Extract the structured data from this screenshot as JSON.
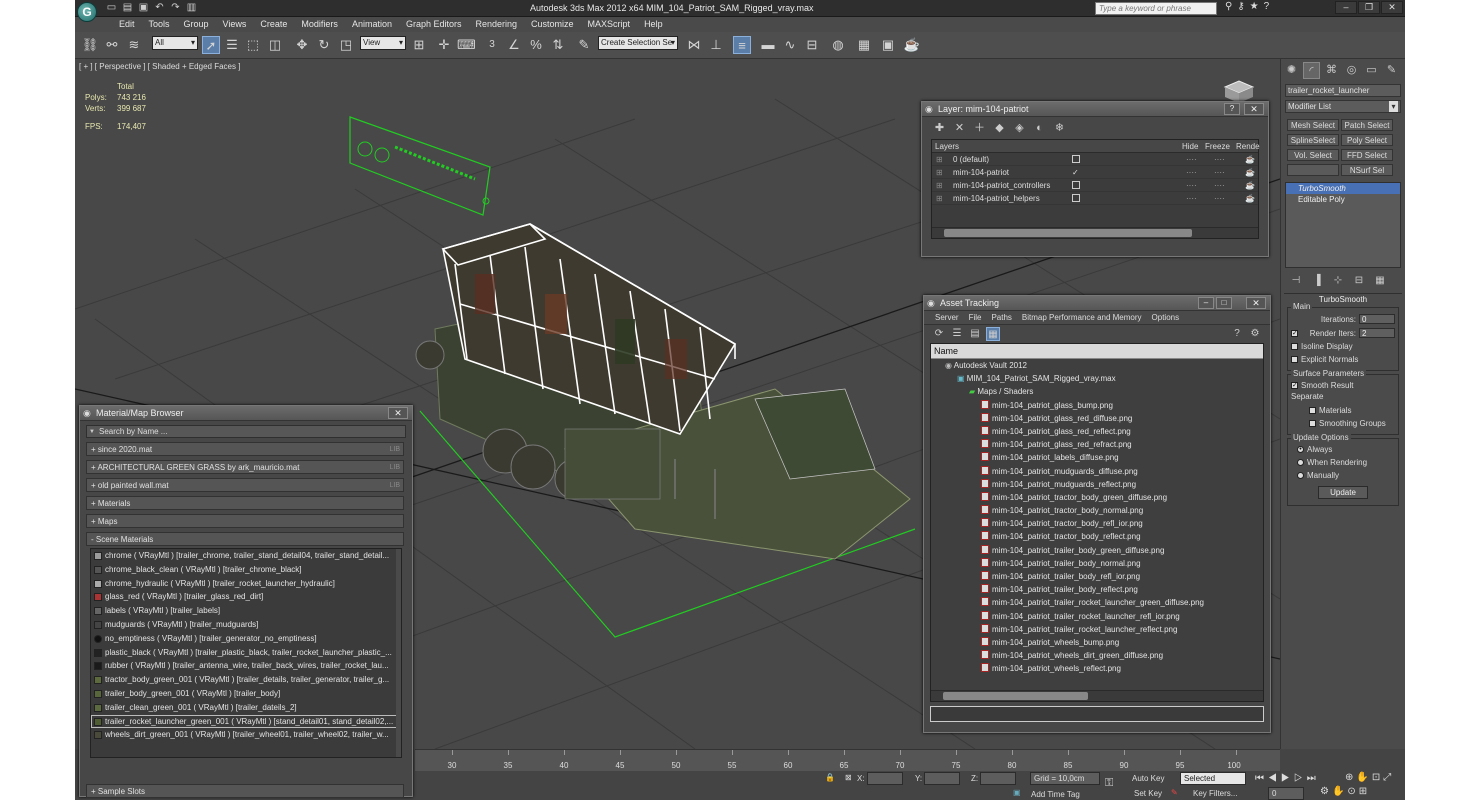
{
  "app": {
    "title": "Autodesk 3ds Max  2012 x64      MIM_104_Patriot_SAM_Rigged_vray.max",
    "logo": "G",
    "search_placeholder": "Type a keyword or phrase"
  },
  "menubar": [
    "Edit",
    "Tools",
    "Group",
    "Views",
    "Create",
    "Modifiers",
    "Animation",
    "Graph Editors",
    "Rendering",
    "Customize",
    "MAXScript",
    "Help"
  ],
  "toolbar": {
    "selection_filter": "All",
    "ref_coord": "View",
    "named_selection": "Create Selection Se",
    "snap_label": "3"
  },
  "viewport": {
    "label": "[ + ] [ Perspective ] [ Shaded + Edged Faces ]",
    "stats_header": "Total",
    "polys_label": "Polys:",
    "polys_value": "743 216",
    "verts_label": "Verts:",
    "verts_value": "399 687",
    "fps_label": "FPS:",
    "fps_value": "174,407"
  },
  "command_panel": {
    "object_name": "trailer_rocket_launcher",
    "modifier_list": "Modifier List",
    "buttons": [
      "Mesh Select",
      "Patch Select",
      "SplineSelect",
      "Poly Select",
      "Vol. Select",
      "FFD Select",
      "",
      "NSurf Sel"
    ],
    "stack": [
      "TurboSmooth",
      "Editable Poly"
    ],
    "turbosmooth": {
      "title": "TurboSmooth",
      "main_label": "Main",
      "iterations_label": "Iterations:",
      "iterations_value": "0",
      "render_iters_label": "Render Iters:",
      "render_iters_value": "2",
      "isoline": "Isoline Display",
      "explicit": "Explicit Normals",
      "surface_label": "Surface Parameters",
      "smooth_result": "Smooth Result",
      "separate": "Separate",
      "materials": "Materials",
      "smoothing_groups": "Smoothing Groups",
      "update_label": "Update Options",
      "always": "Always",
      "when_rendering": "When Rendering",
      "manually": "Manually",
      "update_button": "Update"
    }
  },
  "layers_panel": {
    "title": "Layer: mim-104-patriot",
    "col_layers": "Layers",
    "col_hide": "Hide",
    "col_freeze": "Freeze",
    "col_render": "Rende",
    "rows": [
      {
        "name": "0 (default)",
        "hide": false
      },
      {
        "name": "mim-104-patriot",
        "hide": true
      },
      {
        "name": "mim-104-patriot_controllers",
        "hide": false
      },
      {
        "name": "mim-104-patriot_helpers",
        "hide": false
      }
    ]
  },
  "asset_tracking": {
    "title": "Asset Tracking",
    "menu": [
      "Server",
      "File",
      "Paths",
      "Bitmap Performance and Memory",
      "Options"
    ],
    "col_name": "Name",
    "vault": "Autodesk Vault 2012",
    "file": "MIM_104_Patriot_SAM_Rigged_vray.max",
    "maps_folder": "Maps / Shaders",
    "maps": [
      "mim-104_patriot_glass_bump.png",
      "mim-104_patriot_glass_red_diffuse.png",
      "mim-104_patriot_glass_red_reflect.png",
      "mim-104_patriot_glass_red_refract.png",
      "mim-104_patriot_labels_diffuse.png",
      "mim-104_patriot_mudguards_diffuse.png",
      "mim-104_patriot_mudguards_reflect.png",
      "mim-104_patriot_tractor_body_green_diffuse.png",
      "mim-104_patriot_tractor_body_normal.png",
      "mim-104_patriot_tractor_body_refl_ior.png",
      "mim-104_patriot_tractor_body_reflect.png",
      "mim-104_patriot_trailer_body_green_diffuse.png",
      "mim-104_patriot_trailer_body_normal.png",
      "mim-104_patriot_trailer_body_refl_ior.png",
      "mim-104_patriot_trailer_body_reflect.png",
      "mim-104_patriot_trailer_rocket_launcher_green_diffuse.png",
      "mim-104_patriot_trailer_rocket_launcher_refl_ior.png",
      "mim-104_patriot_trailer_rocket_launcher_reflect.png",
      "mim-104_patriot_wheels_bump.png",
      "mim-104_patriot_wheels_dirt_green_diffuse.png",
      "mim-104_patriot_wheels_reflect.png"
    ]
  },
  "material_browser": {
    "title": "Material/Map Browser",
    "search_placeholder": "Search by Name ...",
    "lib_tag": "LIB",
    "categories": [
      {
        "label": "+ since 2020.mat",
        "lib": true
      },
      {
        "label": "+ ARCHITECTURAL GREEN GRASS by ark_mauricio.mat",
        "lib": true
      },
      {
        "label": "+ old painted wall.mat",
        "lib": true
      },
      {
        "label": "+ Materials",
        "lib": false
      },
      {
        "label": "+ Maps",
        "lib": false
      }
    ],
    "scene_materials_label": "- Scene Materials",
    "scene_materials": [
      "chrome  ( VRayMtl )  [trailer_chrome, trailer_stand_detail04, trailer_stand_detail...",
      "chrome_black_clean  ( VRayMtl )  [trailer_chrome_black]",
      "chrome_hydraulic  ( VRayMtl )  [trailer_rocket_launcher_hydraulic]",
      "glass_red  ( VRayMtl )  [trailer_glass_red_dirt]",
      "labels  ( VRayMtl )  [trailer_labels]",
      "mudguards  ( VRayMtl )  [trailer_mudguards]",
      "no_emptiness  ( VRayMtl )  [trailer_generator_no_emptiness]",
      "plastic_black  ( VRayMtl )  [trailer_plastic_black, trailer_rocket_launcher_plastic_...",
      "rubber  ( VRayMtl )  [trailer_antenna_wire, trailer_back_wires, trailer_rocket_lau...",
      "tractor_body_green_001  ( VRayMtl )  [trailer_details, trailer_generator, trailer_g...",
      "trailer_body_green_001  ( VRayMtl )  [trailer_body]",
      "trailer_clean_green_001  ( VRayMtl )  [trailer_dateils_2]",
      "trailer_rocket_launcher_green_001  ( VRayMtl )  [stand_detail01, stand_detail02,...",
      "wheels_dirt_green_001  ( VRayMtl )  [trailer_wheel01, trailer_wheel02, trailer_w..."
    ],
    "sample_slots": "+ Sample Slots"
  },
  "timeline": {
    "ticks": [
      "30",
      "35",
      "40",
      "45",
      "50",
      "55",
      "60",
      "65",
      "70",
      "75",
      "80",
      "85",
      "90",
      "95",
      "100"
    ]
  },
  "statusbar": {
    "x_label": "X:",
    "y_label": "Y:",
    "z_label": "Z:",
    "grid": "Grid = 10,0cm",
    "auto_key": "Auto Key",
    "selected": "Selected",
    "set_key": "Set Key",
    "key_filters": "Key Filters...",
    "add_time_tag": "Add Time Tag",
    "frame": "0"
  },
  "colors": {
    "accent_blue": "#4870b4",
    "viewport_bg": "#484848",
    "wire_green": "#22cc22",
    "panel_bg": "#474747"
  }
}
